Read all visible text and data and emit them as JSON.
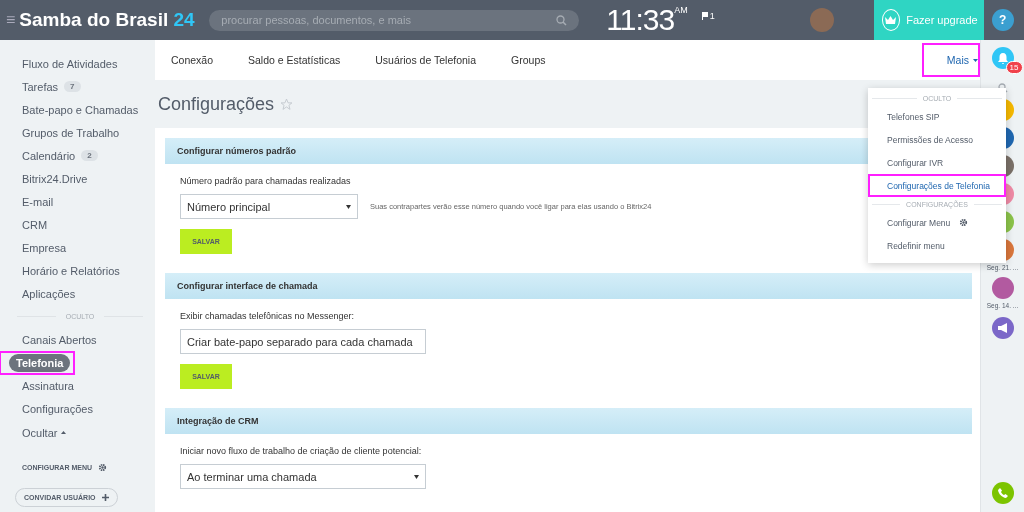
{
  "header": {
    "menu_icon": "≡",
    "title": "Samba do Brasil",
    "title_suffix": "24",
    "search": {
      "placeholder": "procurar pessoas, documentos, e mais"
    },
    "clock": "11:33",
    "clock_period": "AM",
    "flag_count": "1",
    "upgrade": "Fazer upgrade",
    "help": "?"
  },
  "sidebar": {
    "items": [
      {
        "label": "Fluxo de Atividades",
        "selected": false,
        "highlighted": false
      },
      {
        "label": "Tarefas",
        "badge": "7",
        "selected": false,
        "highlighted": false
      },
      {
        "label": "Bate-papo e Chamadas",
        "selected": false,
        "highlighted": false
      },
      {
        "label": "Grupos de Trabalho",
        "selected": false,
        "highlighted": false
      },
      {
        "label": "Calendário",
        "badge": "2",
        "selected": false,
        "highlighted": false
      },
      {
        "label": "Bitrix24.Drive",
        "selected": false,
        "highlighted": false
      },
      {
        "label": "E-mail",
        "selected": false,
        "highlighted": false
      },
      {
        "label": "CRM",
        "selected": false,
        "highlighted": false
      },
      {
        "label": "Empresa",
        "selected": false,
        "highlighted": false
      },
      {
        "label": "Horário e Relatórios",
        "selected": false,
        "highlighted": false
      },
      {
        "label": "Aplicações",
        "selected": false,
        "highlighted": false
      }
    ],
    "hidden_heading": "OCULTO",
    "hidden_items": [
      {
        "label": "Canais Abertos",
        "selected": false,
        "highlighted": false
      },
      {
        "label": "Telefonia",
        "selected": true,
        "highlighted": true
      },
      {
        "label": "Assinatura",
        "selected": false,
        "highlighted": false
      },
      {
        "label": "Configurações",
        "selected": false,
        "highlighted": false
      }
    ],
    "toggle": "Ocultar",
    "configure_menu": "CONFIGURAR MENU",
    "invite": "CONVIDAR USUÁRIO"
  },
  "tabs": [
    {
      "label": "Conexão",
      "selected": false,
      "highlighted": false
    },
    {
      "label": "Saldo e Estatísticas",
      "selected": false,
      "highlighted": false
    },
    {
      "label": "Usuários de Telefonia",
      "selected": false,
      "highlighted": false
    },
    {
      "label": "Groups",
      "selected": false,
      "highlighted": false
    },
    {
      "label": "Mais",
      "kind": "more",
      "selected": false,
      "highlighted": true
    }
  ],
  "page_title": "Configurações",
  "sections": [
    {
      "title": "Configurar números padrão",
      "label": "Número padrão para chamadas realizadas",
      "select": "Número principal",
      "hint": "Suas contrapartes verão esse número quando você ligar para elas usando o Bitrix24",
      "button": "SALVAR"
    },
    {
      "title": "Configurar interface de chamada",
      "label": "Exibir chamadas telefônicas no Messenger:",
      "select": "Criar bate-papo separado para cada chamada",
      "button": "SALVAR"
    },
    {
      "title": "Integração de CRM",
      "label": "Iniciar novo fluxo de trabalho de criação de cliente potencial:",
      "select": "Ao terminar uma chamada"
    }
  ],
  "dropdown": {
    "items": [
      {
        "kind": "heading",
        "label": "OCULTO"
      },
      {
        "kind": "item",
        "label": "Telefones SIP",
        "selected": false,
        "highlighted": false
      },
      {
        "kind": "item",
        "label": "Permissões de Acesso",
        "selected": false,
        "highlighted": false
      },
      {
        "kind": "item",
        "label": "Configurar IVR",
        "selected": false,
        "highlighted": false
      },
      {
        "kind": "item",
        "label": "Configurações de Telefonia",
        "selected": true,
        "highlighted": true
      },
      {
        "kind": "heading",
        "label": "CONFIGURAÇÕES"
      },
      {
        "kind": "settings",
        "label": "Configurar Menu",
        "selected": false,
        "highlighted": false
      },
      {
        "kind": "item",
        "label": "Redefinir menu",
        "selected": false,
        "highlighted": false
      }
    ]
  },
  "rightbar": {
    "notifications": "15",
    "contacts": [
      {
        "kind": "search"
      },
      {
        "kind": "avatar"
      },
      {
        "kind": "avatar"
      },
      {
        "kind": "avatar"
      },
      {
        "kind": "avatar"
      },
      {
        "kind": "avatar"
      },
      {
        "kind": "avatar",
        "caption": "Seg. 21. ..."
      },
      {
        "kind": "avatar",
        "caption": "Seg. 14. ..."
      },
      {
        "kind": "announcement"
      }
    ]
  }
}
